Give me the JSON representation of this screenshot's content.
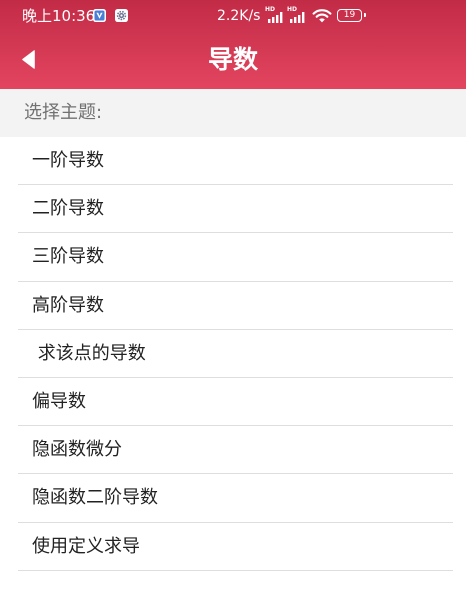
{
  "status_bar": {
    "time": "晚上10:36",
    "network_speed": "2.2K/s",
    "signal_1_label": "HD",
    "signal_2_label": "HD",
    "battery_level": "19",
    "notification_icons": [
      "app-notification-icon",
      "settings-notification-icon"
    ],
    "system_icons": [
      "signal-icon",
      "signal-icon",
      "wifi-icon",
      "battery-icon"
    ]
  },
  "toolbar": {
    "back_icon": "back-arrow-icon",
    "title": "导数"
  },
  "topic_header": {
    "label": "选择主题:"
  },
  "topics": [
    {
      "label": "一阶导数"
    },
    {
      "label": "二阶导数"
    },
    {
      "label": "三阶导数"
    },
    {
      "label": "高阶导数"
    },
    {
      "label": " 求该点的导数"
    },
    {
      "label": "偏导数"
    },
    {
      "label": "隐函数微分"
    },
    {
      "label": "隐函数二阶导数"
    },
    {
      "label": "使用定义求导"
    }
  ],
  "colors": {
    "header_gradient_top": "#c22b46",
    "header_gradient_bottom": "#e3455f",
    "section_background": "#f3f3f3",
    "section_text": "#717171",
    "item_text": "#222222",
    "divider": "#dedede"
  }
}
